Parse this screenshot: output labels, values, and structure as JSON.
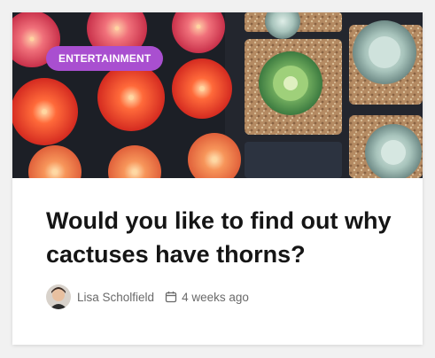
{
  "post": {
    "category": "ENTERTAINMENT",
    "title": "Would you like to find out why cactuses have thorns?",
    "author": "Lisa Scholfield",
    "date": "4 weeks ago"
  },
  "colors": {
    "badge": "#a94fd0",
    "title": "#151515",
    "meta": "#6a6a6a",
    "card": "#ffffff",
    "page": "#f1f1f1"
  },
  "icons": {
    "date": "calendar-icon",
    "author": "avatar"
  }
}
